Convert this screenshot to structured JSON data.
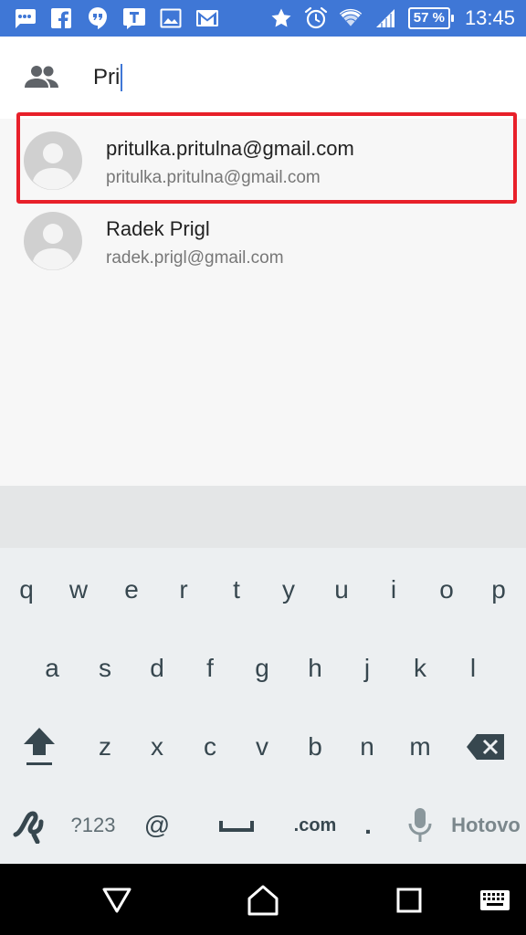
{
  "status_bar": {
    "time": "13:45",
    "battery": "57 %",
    "left_icons": [
      "chat-bubble-icon",
      "facebook-icon",
      "hangouts-icon",
      "t-app-icon",
      "image-icon",
      "gmail-icon"
    ],
    "right_icons": [
      "star-icon",
      "alarm-icon",
      "wifi-icon",
      "signal-icon",
      "battery-icon"
    ]
  },
  "search": {
    "value": "Pri"
  },
  "results": [
    {
      "name": "pritulka.pritulna@gmail.com",
      "email": "pritulka.pritulna@gmail.com",
      "highlighted": true
    },
    {
      "name": "Radek Prigl",
      "email": "radek.prigl@gmail.com",
      "highlighted": false
    }
  ],
  "keyboard": {
    "row1": [
      "q",
      "w",
      "e",
      "r",
      "t",
      "y",
      "u",
      "i",
      "o",
      "p"
    ],
    "row2": [
      "a",
      "s",
      "d",
      "f",
      "g",
      "h",
      "j",
      "k",
      "l"
    ],
    "row3": [
      "z",
      "x",
      "c",
      "v",
      "b",
      "n",
      "m"
    ],
    "row4": {
      "symbols": "?123",
      "at": "@",
      "dotcom": ".com",
      "dot": ".",
      "done": "Hotovo"
    }
  },
  "colors": {
    "status_bar": "#3f77d6",
    "highlight": "#e8202a",
    "key_text": "#37474f"
  }
}
